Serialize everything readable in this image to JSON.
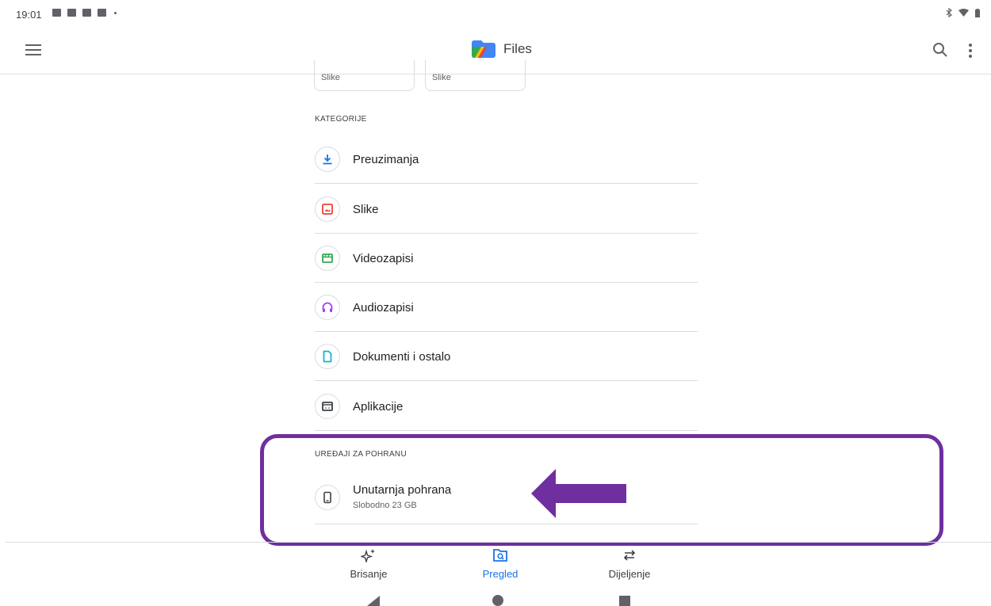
{
  "status_bar": {
    "time": "19:01"
  },
  "app_bar": {
    "title": "Files"
  },
  "chips": [
    "Slike",
    "Slike"
  ],
  "categories": {
    "header": "KATEGORIJE",
    "items": [
      {
        "label": "Preuzimanja",
        "icon": "download-icon",
        "color": "#1a73e8"
      },
      {
        "label": "Slike",
        "icon": "image-icon",
        "color": "#ea4335"
      },
      {
        "label": "Videozapisi",
        "icon": "video-icon",
        "color": "#34a853"
      },
      {
        "label": "Audiozapisi",
        "icon": "headphones-icon",
        "color": "#a142f4"
      },
      {
        "label": "Dokumenti i ostalo",
        "icon": "document-icon",
        "color": "#12b5cb"
      },
      {
        "label": "Aplikacije",
        "icon": "apps-icon",
        "color": "#3c4043"
      }
    ]
  },
  "storage": {
    "header": "UREĐAJI ZA POHRANU",
    "item": {
      "title": "Unutarnja pohrana",
      "subtitle": "Slobodno 23 GB",
      "icon": "phone-icon"
    }
  },
  "annotation": {
    "color": "#6f2f9f"
  },
  "bottom_nav": {
    "items": [
      {
        "label": "Brisanje",
        "icon": "sparkle-icon",
        "active": false
      },
      {
        "label": "Pregled",
        "icon": "browse-icon",
        "active": true
      },
      {
        "label": "Dijeljenje",
        "icon": "swap-icon",
        "active": false
      }
    ],
    "active_color": "#1a73e8"
  }
}
